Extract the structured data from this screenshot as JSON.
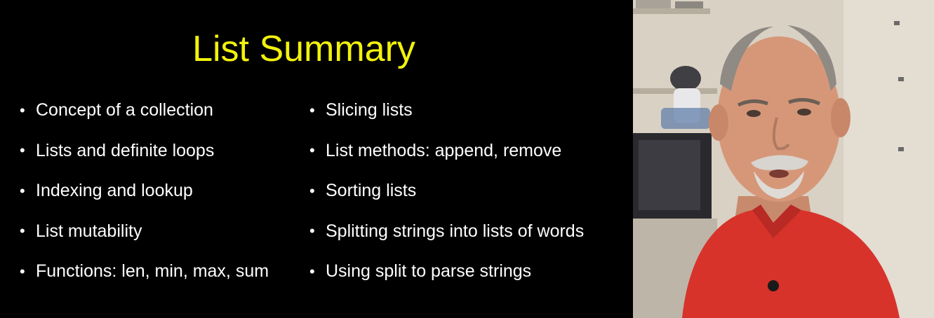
{
  "slide": {
    "title": "List Summary",
    "bullet_symbol": "•",
    "left_column": [
      "Concept of a collection",
      "Lists and definite loops",
      "Indexing and lookup",
      "List mutability",
      "Functions: len, min, max, sum"
    ],
    "right_column": [
      "Slicing lists",
      "List methods: append,  remove",
      "Sorting lists",
      "Splitting strings into lists of words",
      "Using split to parse strings"
    ],
    "colors": {
      "background": "#000000",
      "title": "#f2f20c",
      "text": "#ffffff"
    }
  },
  "webcam": {
    "subject": "presenter-video-feed",
    "shirt_color": "#d7332b"
  }
}
